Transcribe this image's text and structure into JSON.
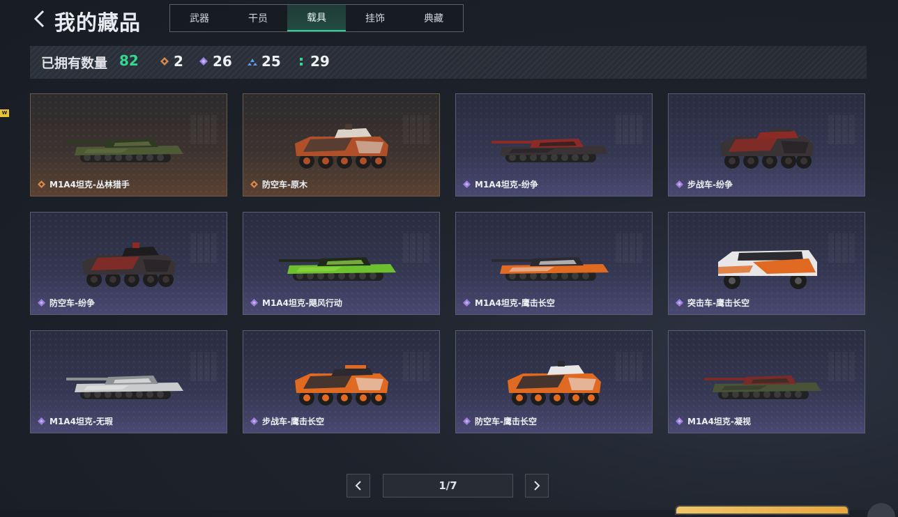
{
  "header": {
    "title": "我的藏品",
    "tabs": [
      {
        "label": "武器",
        "active": false
      },
      {
        "label": "干员",
        "active": false
      },
      {
        "label": "载具",
        "active": true
      },
      {
        "label": "挂饰",
        "active": false
      },
      {
        "label": "典藏",
        "active": false
      }
    ]
  },
  "stats": {
    "label": "已拥有数量",
    "total": "82",
    "items": [
      {
        "icon": "orange-diamond-icon",
        "color": "#d9874a",
        "value": "2"
      },
      {
        "icon": "purple-diamond-icon",
        "color": "#9d7fe0",
        "value": "26"
      },
      {
        "icon": "blue-triangle-icon",
        "color": "#5aa0e6",
        "value": "25"
      },
      {
        "icon": "green-dots-icon",
        "color": "#3ad39a",
        "value": "29"
      }
    ]
  },
  "vehicles": [
    {
      "name": "M1A4坦克-丛林猎手",
      "rarity": "orange",
      "type": "tank",
      "camo": "jungle"
    },
    {
      "name": "防空车-原木",
      "rarity": "orange",
      "type": "aa",
      "camo": "wood"
    },
    {
      "name": "M1A4坦克-纷争",
      "rarity": "purple",
      "type": "tank",
      "camo": "conflict"
    },
    {
      "name": "步战车-纷争",
      "rarity": "purple",
      "type": "ifv",
      "camo": "conflict"
    },
    {
      "name": "防空车-纷争",
      "rarity": "purple",
      "type": "aa",
      "camo": "conflict"
    },
    {
      "name": "M1A4坦克-飓风行动",
      "rarity": "purple",
      "type": "tank",
      "camo": "hurricane"
    },
    {
      "name": "M1A4坦克-鹰击长空",
      "rarity": "purple",
      "type": "tank",
      "camo": "eagle"
    },
    {
      "name": "突击车-鹰击长空",
      "rarity": "purple",
      "type": "truck",
      "camo": "eagle"
    },
    {
      "name": "M1A4坦克-无瑕",
      "rarity": "purple",
      "type": "tank",
      "camo": "flawless"
    },
    {
      "name": "步战车-鹰击长空",
      "rarity": "purple",
      "type": "ifv",
      "camo": "eagle"
    },
    {
      "name": "防空车-鹰击长空",
      "rarity": "purple",
      "type": "aa",
      "camo": "eagle"
    },
    {
      "name": "M1A4坦克-凝视",
      "rarity": "purple",
      "type": "tank",
      "camo": "gaze"
    }
  ],
  "pagination": {
    "text": "1/7"
  },
  "side_tag": "W"
}
